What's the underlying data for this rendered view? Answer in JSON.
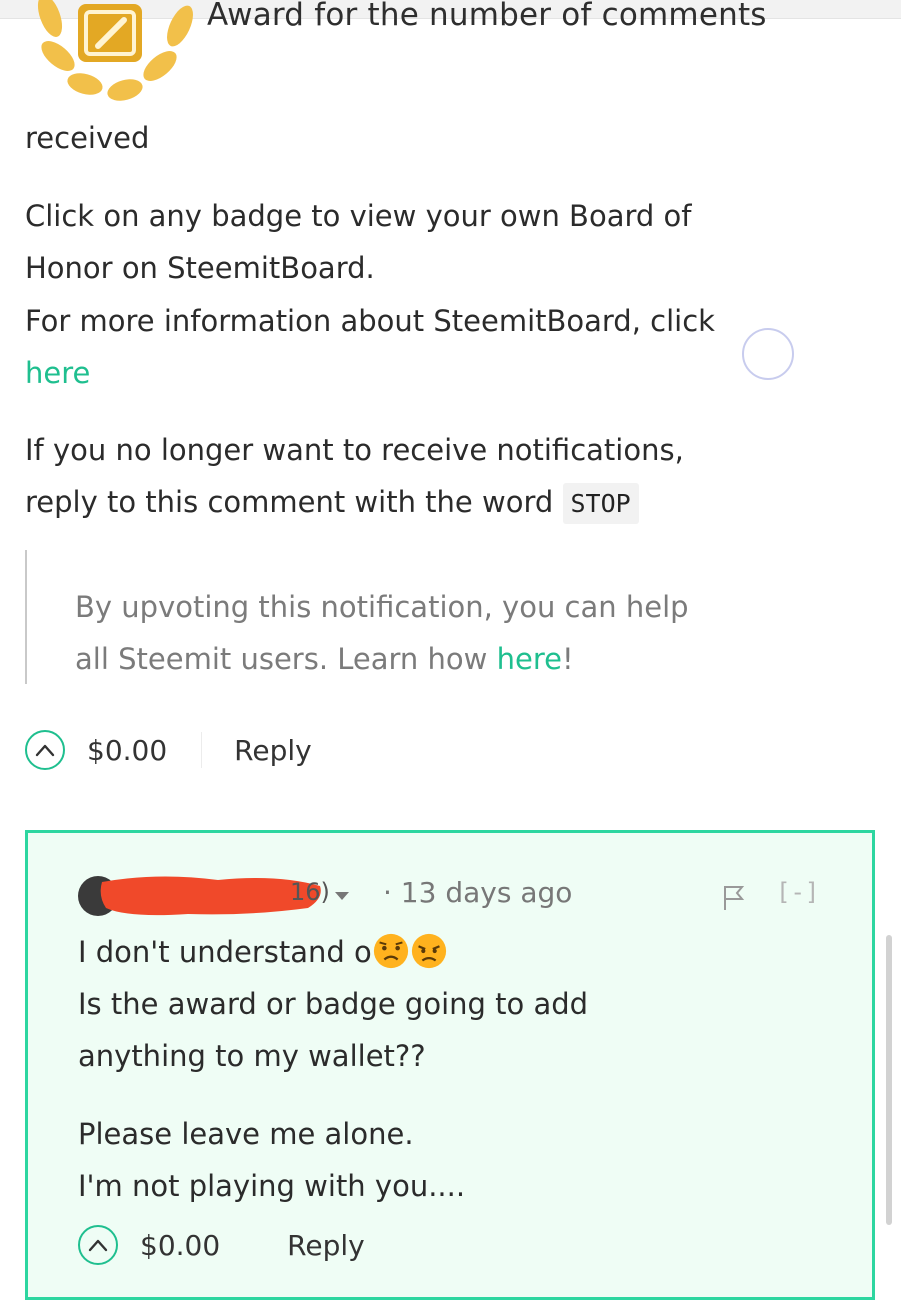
{
  "badge": {
    "caption": "Award for the number of comments",
    "caption_cont": "received",
    "icon": "laurel-pencil-badge-icon",
    "colors": {
      "gold": "#f2c04a",
      "gold_dark": "#e3a824"
    }
  },
  "body": {
    "line1": "Click on any badge to view your own Board of",
    "line2": "Honor on SteemitBoard.",
    "line3": "For more information about SteemitBoard, click",
    "link_here": "here",
    "line4": "If you no longer want to receive notifications,",
    "line5_prefix": "reply to this comment with the word",
    "stop_word": "STOP"
  },
  "quote": {
    "line1": "By upvoting this notification, you can help",
    "line2_prefix": "all Steemit users. Learn how ",
    "line2_link": "here",
    "line2_suffix": "!"
  },
  "post_actions": {
    "payout": "$0.00",
    "reply": "Reply"
  },
  "reply_comment": {
    "author_reputation_visible": "16)",
    "time_ago": "· 13 days ago",
    "collapse": "[-]",
    "line1": "I don't understand o",
    "emojis": [
      "worried-face-icon",
      "angry-face-icon"
    ],
    "line2": "Is the award or badge going to add",
    "line3": "anything to my wallet??",
    "line4": "Please leave me alone.",
    "line5": "I'm not playing with you....",
    "payout": "$0.00",
    "reply": "Reply"
  },
  "colors": {
    "accent": "#1fbf8f",
    "reply_bg": "#effdf5",
    "reply_border": "#2dd6a0",
    "redaction": "#f0492a"
  }
}
